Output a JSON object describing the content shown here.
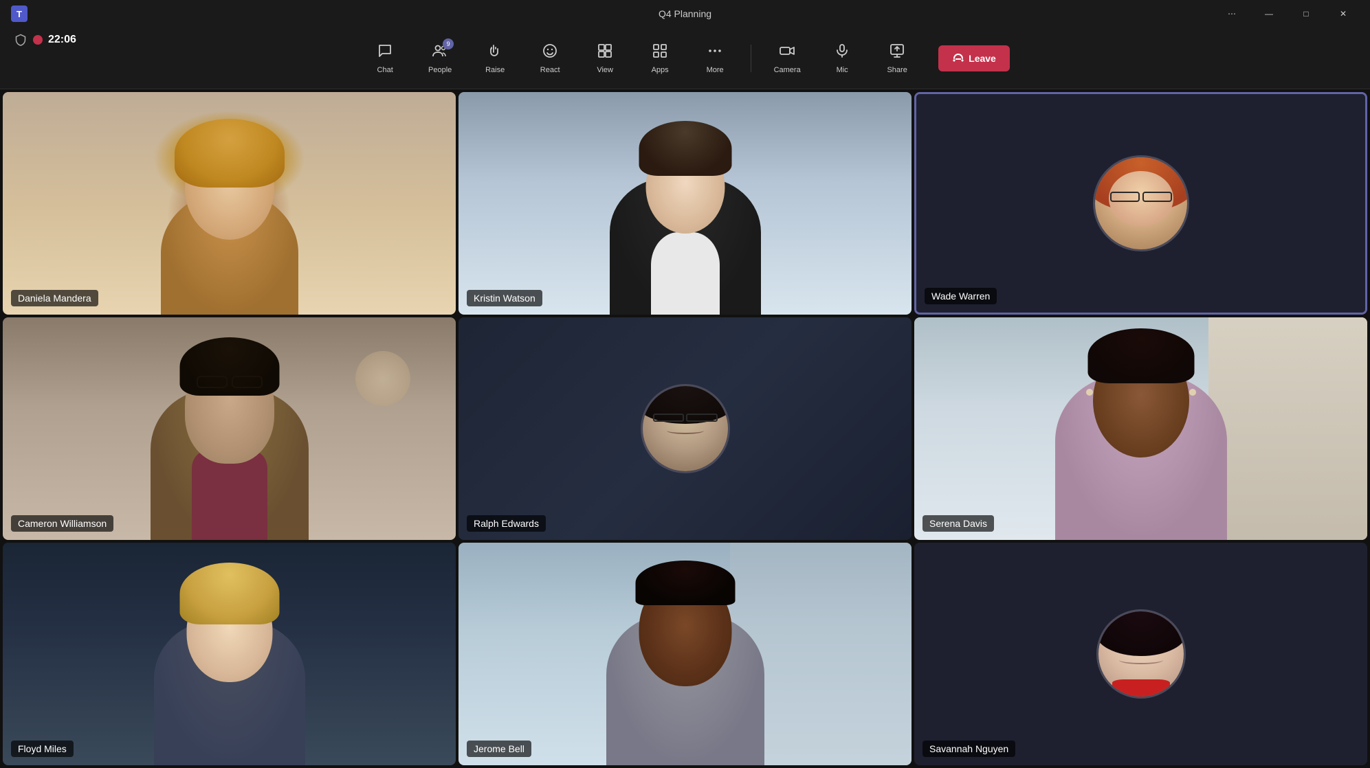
{
  "titleBar": {
    "title": "Q4 Planning",
    "windowControls": {
      "more": "⋯",
      "minimize": "—",
      "maximize": "□",
      "close": "✕"
    }
  },
  "toolbar": {
    "chat": {
      "label": "Chat",
      "icon": "💬"
    },
    "people": {
      "label": "People",
      "icon": "👥",
      "badge": "9"
    },
    "raise": {
      "label": "Raise",
      "icon": "✋"
    },
    "react": {
      "label": "React",
      "icon": "😊"
    },
    "view": {
      "label": "View",
      "icon": "⊞"
    },
    "apps": {
      "label": "Apps",
      "icon": "⊞"
    },
    "more": {
      "label": "More",
      "icon": "⋯"
    },
    "camera": {
      "label": "Camera",
      "icon": "📹"
    },
    "mic": {
      "label": "Mic",
      "icon": "🎤"
    },
    "share": {
      "label": "Share",
      "icon": "⬆"
    },
    "leave": {
      "label": "Leave",
      "icon": "📞"
    }
  },
  "statusBar": {
    "timer": "22:06",
    "isRecording": true
  },
  "participants": [
    {
      "id": "daniela",
      "name": "Daniela Mandera",
      "hasVideo": true,
      "isActive": false
    },
    {
      "id": "kristin",
      "name": "Kristin Watson",
      "hasVideo": true,
      "isActive": false
    },
    {
      "id": "wade",
      "name": "Wade Warren",
      "hasVideo": false,
      "isActive": true
    },
    {
      "id": "cameron",
      "name": "Cameron Williamson",
      "hasVideo": true,
      "isActive": false
    },
    {
      "id": "ralph",
      "name": "Ralph Edwards",
      "hasVideo": false,
      "isActive": false
    },
    {
      "id": "serena",
      "name": "Serena Davis",
      "hasVideo": true,
      "isActive": false
    },
    {
      "id": "floyd",
      "name": "Floyd Miles",
      "hasVideo": true,
      "isActive": false
    },
    {
      "id": "jerome",
      "name": "Jerome Bell",
      "hasVideo": true,
      "isActive": false
    },
    {
      "id": "savannah",
      "name": "Savannah Nguyen",
      "hasVideo": false,
      "isActive": false
    }
  ],
  "colors": {
    "accent": "#6264a7",
    "leave": "#c4314b",
    "background": "#1a1a1a",
    "cellBg": "#2a2a2e"
  }
}
